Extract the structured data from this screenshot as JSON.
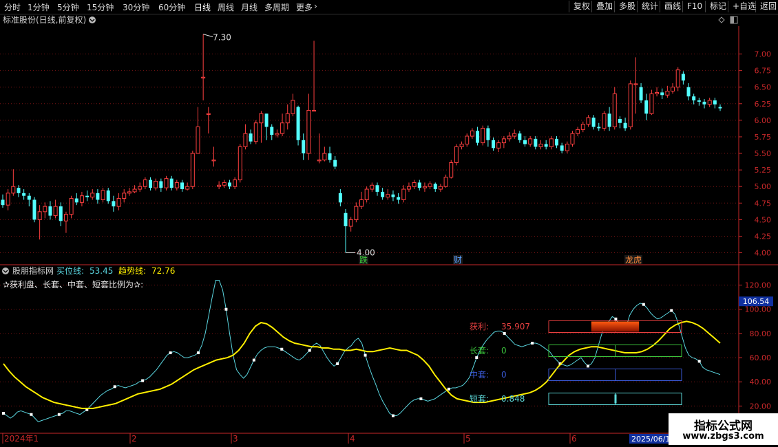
{
  "toolbar": {
    "periods": [
      "分时",
      "1分钟",
      "5分钟",
      "15分钟",
      "30分钟",
      "60分钟",
      "日线",
      "周线",
      "月线",
      "多周期",
      "更多"
    ],
    "active": "日线",
    "right": [
      "复权",
      "叠加",
      "多股",
      "统计",
      "画线",
      "F10",
      "标记",
      "+自选",
      "返回"
    ]
  },
  "main_title": "标准股份(日线,前复权)",
  "indicator": {
    "name": "股朋指标网",
    "buy_label": "买位线:",
    "buy_value": "53.45",
    "trend_label": "趋势线:",
    "trend_value": "72.76",
    "desc": "✰获利盘、长套、中套、短套比例为✰:"
  },
  "panel": {
    "rows": [
      {
        "label": "获利:",
        "value": "35.907",
        "color": "#e84040",
        "fraction": 0.35907,
        "type": "fill"
      },
      {
        "label": "长套:",
        "value": "0",
        "color": "#3cc43c",
        "fraction": 0,
        "type": "tick"
      },
      {
        "label": "中套:",
        "value": "0",
        "color": "#3a5ad8",
        "fraction": 0,
        "type": "tick"
      },
      {
        "label": "短套:",
        "value": "0.848",
        "color": "#5dd8d8",
        "fraction": 0.00848,
        "type": "tick"
      }
    ]
  },
  "current_value_tag": "106.54",
  "events": [
    {
      "text": "跌",
      "color": "#3cd03c"
    },
    {
      "text": "财",
      "color": "#5aa0ff"
    },
    {
      "text": "龙虎",
      "color": "#ff8a3a"
    }
  ],
  "time_axis": {
    "labels": [
      "2024年1",
      "2",
      "3",
      "4",
      "5",
      "6"
    ],
    "end_label": "2025/06/1"
  },
  "watermark": {
    "line1": "指标公式网",
    "line2": "www.zbgs3.com"
  },
  "chart_data": [
    {
      "type": "candlestick",
      "title": "标准股份(日线,前复权)",
      "ylim": [
        3.85,
        7.4
      ],
      "yticks": [
        4.0,
        4.25,
        4.5,
        4.75,
        5.0,
        5.25,
        5.5,
        5.75,
        6.0,
        6.25,
        6.5,
        6.75,
        7.0
      ],
      "high_label": "7.30",
      "low_label": "4.00",
      "candles": [
        [
          4.8,
          4.72,
          4.88,
          4.68
        ],
        [
          4.72,
          4.9,
          4.96,
          4.64
        ],
        [
          4.9,
          5.0,
          5.26,
          4.86
        ],
        [
          4.98,
          4.9,
          5.02,
          4.84
        ],
        [
          4.9,
          4.86,
          4.96,
          4.8
        ],
        [
          4.86,
          4.8,
          4.9,
          4.7
        ],
        [
          4.8,
          4.5,
          4.84,
          4.46
        ],
        [
          4.5,
          4.62,
          4.72,
          4.2
        ],
        [
          4.62,
          4.7,
          4.76,
          4.52
        ],
        [
          4.7,
          4.56,
          4.78,
          4.5
        ],
        [
          4.56,
          4.7,
          4.8,
          4.52
        ],
        [
          4.7,
          4.48,
          4.76,
          4.4
        ],
        [
          4.48,
          4.58,
          4.62,
          4.3
        ],
        [
          4.58,
          4.82,
          4.86,
          4.52
        ],
        [
          4.82,
          4.76,
          4.9,
          4.72
        ],
        [
          4.76,
          4.86,
          4.92,
          4.7
        ],
        [
          4.86,
          4.84,
          4.94,
          4.78
        ],
        [
          4.84,
          4.9,
          4.96,
          4.8
        ],
        [
          4.9,
          4.8,
          4.96,
          4.74
        ],
        [
          4.8,
          4.94,
          4.98,
          4.76
        ],
        [
          4.94,
          4.78,
          4.98,
          4.74
        ],
        [
          4.78,
          4.7,
          4.86,
          4.62
        ],
        [
          4.7,
          4.82,
          4.9,
          4.64
        ],
        [
          4.82,
          4.9,
          4.96,
          4.76
        ],
        [
          4.9,
          4.92,
          4.98,
          4.86
        ],
        [
          4.92,
          4.96,
          5.02,
          4.9
        ],
        [
          4.96,
          5.0,
          5.06,
          4.92
        ],
        [
          5.0,
          5.1,
          5.14,
          4.96
        ],
        [
          5.1,
          4.98,
          5.14,
          4.94
        ],
        [
          4.98,
          5.08,
          5.12,
          4.94
        ],
        [
          5.08,
          4.98,
          5.12,
          4.92
        ],
        [
          4.98,
          5.12,
          5.16,
          4.94
        ],
        [
          5.12,
          4.98,
          5.16,
          4.94
        ],
        [
          4.98,
          5.06,
          5.1,
          4.94
        ],
        [
          5.06,
          4.96,
          5.1,
          4.92
        ],
        [
          4.96,
          5.0,
          5.06,
          4.94
        ],
        [
          5.0,
          5.5,
          5.54,
          4.96
        ],
        [
          5.5,
          5.9,
          6.2,
          5.5
        ],
        [
          6.65,
          6.65,
          7.3,
          6.3
        ],
        [
          6.1,
          6.1,
          6.2,
          5.8
        ],
        [
          5.4,
          5.4,
          5.6,
          5.3
        ],
        [
          5.0,
          5.02,
          5.08,
          4.96
        ],
        [
          5.02,
          5.06,
          5.1,
          4.98
        ],
        [
          5.06,
          5.0,
          5.1,
          4.96
        ],
        [
          5.0,
          5.1,
          5.14,
          4.96
        ],
        [
          5.1,
          5.6,
          5.64,
          5.06
        ],
        [
          5.6,
          5.8,
          5.94,
          5.56
        ],
        [
          5.8,
          5.68,
          5.86,
          5.64
        ],
        [
          5.68,
          5.96,
          6.0,
          5.64
        ],
        [
          5.96,
          6.1,
          6.14,
          5.66
        ],
        [
          6.1,
          5.9,
          6.1,
          5.7
        ],
        [
          5.9,
          5.78,
          5.94,
          5.7
        ],
        [
          5.78,
          5.8,
          5.86,
          5.74
        ],
        [
          5.8,
          5.96,
          6.1,
          5.76
        ],
        [
          5.96,
          6.1,
          6.24,
          5.86
        ],
        [
          6.1,
          6.3,
          6.4,
          6.06
        ],
        [
          6.2,
          5.7,
          6.22,
          5.62
        ],
        [
          5.7,
          5.5,
          5.8,
          5.4
        ],
        [
          5.5,
          6.15,
          6.4,
          5.4
        ],
        [
          6.15,
          6.15,
          7.2,
          6.15
        ],
        [
          5.4,
          5.4,
          5.8,
          5.35
        ],
        [
          5.4,
          5.5,
          5.6,
          5.38
        ],
        [
          5.5,
          5.4,
          5.6,
          5.36
        ],
        [
          5.4,
          5.3,
          5.46,
          5.26
        ],
        [
          4.9,
          4.76,
          4.96,
          4.7
        ],
        [
          4.6,
          4.4,
          4.66,
          4.0
        ],
        [
          4.4,
          4.5,
          4.54,
          4.32
        ],
        [
          4.5,
          4.7,
          4.76,
          4.46
        ],
        [
          4.7,
          4.8,
          4.92,
          4.66
        ],
        [
          4.8,
          4.96,
          5.0,
          4.76
        ],
        [
          4.96,
          5.02,
          5.06,
          4.92
        ],
        [
          5.02,
          4.92,
          5.06,
          4.86
        ],
        [
          4.92,
          4.84,
          4.98,
          4.8
        ],
        [
          4.84,
          4.88,
          4.96,
          4.8
        ],
        [
          4.88,
          4.84,
          4.94,
          4.78
        ],
        [
          4.84,
          4.8,
          4.9,
          4.74
        ],
        [
          4.8,
          4.96,
          5.02,
          4.76
        ],
        [
          4.96,
          5.0,
          5.06,
          4.92
        ],
        [
          5.0,
          5.06,
          5.1,
          4.96
        ],
        [
          5.06,
          4.98,
          5.1,
          4.94
        ],
        [
          4.98,
          5.0,
          5.06,
          4.92
        ],
        [
          5.0,
          5.04,
          5.08,
          4.96
        ],
        [
          5.04,
          4.96,
          5.06,
          4.92
        ],
        [
          4.96,
          5.0,
          5.04,
          4.92
        ],
        [
          5.0,
          5.14,
          5.18,
          4.98
        ],
        [
          5.14,
          5.36,
          5.4,
          5.12
        ],
        [
          5.36,
          5.6,
          5.64,
          5.32
        ],
        [
          5.6,
          5.64,
          5.68,
          5.56
        ],
        [
          5.64,
          5.76,
          5.8,
          5.6
        ],
        [
          5.76,
          5.84,
          5.88,
          5.72
        ],
        [
          5.84,
          5.66,
          5.9,
          5.62
        ],
        [
          5.66,
          5.88,
          5.92,
          5.62
        ],
        [
          5.88,
          5.7,
          5.92,
          5.6
        ],
        [
          5.7,
          5.58,
          5.74,
          5.54
        ],
        [
          5.58,
          5.66,
          5.7,
          5.52
        ],
        [
          5.66,
          5.72,
          5.76,
          5.58
        ],
        [
          5.72,
          5.76,
          5.82,
          5.68
        ],
        [
          5.76,
          5.8,
          5.86,
          5.72
        ],
        [
          5.8,
          5.7,
          5.84,
          5.66
        ],
        [
          5.7,
          5.64,
          5.76,
          5.6
        ],
        [
          5.64,
          5.72,
          5.76,
          5.6
        ],
        [
          5.72,
          5.6,
          5.76,
          5.56
        ],
        [
          5.6,
          5.64,
          5.7,
          5.56
        ],
        [
          5.64,
          5.6,
          5.7,
          5.56
        ],
        [
          5.6,
          5.72,
          5.76,
          5.56
        ],
        [
          5.72,
          5.62,
          5.76,
          5.58
        ],
        [
          5.62,
          5.54,
          5.66,
          5.5
        ],
        [
          5.54,
          5.64,
          5.68,
          5.5
        ],
        [
          5.64,
          5.8,
          5.84,
          5.6
        ],
        [
          5.8,
          5.86,
          5.9,
          5.76
        ],
        [
          5.86,
          5.94,
          5.98,
          5.82
        ],
        [
          5.94,
          6.04,
          6.08,
          5.9
        ],
        [
          6.04,
          5.9,
          6.08,
          5.86
        ],
        [
          5.9,
          5.88,
          5.96,
          5.84
        ],
        [
          5.88,
          6.1,
          6.14,
          5.84
        ],
        [
          6.1,
          5.9,
          6.2,
          5.84
        ],
        [
          5.9,
          6.4,
          6.5,
          5.86
        ],
        [
          6.02,
          5.96,
          6.06,
          5.88
        ],
        [
          5.96,
          5.88,
          6.04,
          5.84
        ],
        [
          5.9,
          6.55,
          6.6,
          5.86
        ],
        [
          6.55,
          6.55,
          6.95,
          6.1
        ],
        [
          6.5,
          6.3,
          6.56,
          6.26
        ],
        [
          6.3,
          6.1,
          6.4,
          6.0
        ],
        [
          6.1,
          6.4,
          6.46,
          6.08
        ],
        [
          6.4,
          6.42,
          6.5,
          6.36
        ],
        [
          6.42,
          6.38,
          6.48,
          6.32
        ],
        [
          6.38,
          6.44,
          6.52,
          6.34
        ],
        [
          6.44,
          6.5,
          6.56,
          6.4
        ],
        [
          6.5,
          6.76,
          6.8,
          6.44
        ],
        [
          6.7,
          6.6,
          6.74,
          6.54
        ],
        [
          6.5,
          6.36,
          6.56,
          6.3
        ],
        [
          6.36,
          6.3,
          6.4,
          6.24
        ],
        [
          6.3,
          6.28,
          6.34,
          6.22
        ],
        [
          6.28,
          6.24,
          6.32,
          6.18
        ],
        [
          6.24,
          6.3,
          6.34,
          6.2
        ],
        [
          6.3,
          6.24,
          6.34,
          6.18
        ],
        [
          6.2,
          6.18,
          6.24,
          6.14
        ]
      ]
    },
    {
      "type": "line",
      "title": "股朋指标网",
      "ylim": [
        10,
        126
      ],
      "yticks": [
        20,
        40,
        60,
        80,
        100,
        120
      ],
      "series": [
        {
          "name": "买位线",
          "color": "#5ad6e0",
          "marker_every": 8,
          "values": [
            14,
            12,
            10,
            12,
            15,
            16,
            15,
            14,
            13,
            10,
            7,
            8,
            9,
            10,
            11,
            12,
            13,
            14,
            16,
            16,
            15,
            14,
            13,
            15,
            17,
            20,
            23,
            26,
            29,
            31,
            33,
            34,
            36,
            37,
            36,
            35,
            36,
            37,
            38,
            40,
            41,
            42,
            44,
            47,
            50,
            54,
            58,
            62,
            64,
            65,
            64,
            62,
            60,
            60,
            61,
            62,
            64,
            70,
            80,
            95,
            110,
            124,
            124,
            116,
            100,
            80,
            62,
            50,
            46,
            43,
            46,
            52,
            58,
            63,
            66,
            68,
            69,
            69,
            69,
            68,
            67,
            65,
            63,
            61,
            59,
            58,
            60,
            63,
            66,
            70,
            72,
            70,
            65,
            60,
            56,
            53,
            55,
            60,
            65,
            68,
            70,
            74,
            76,
            72,
            62,
            53,
            45,
            38,
            30,
            24,
            19,
            14,
            12,
            12,
            14,
            17,
            20,
            23,
            25,
            26,
            26,
            25,
            24,
            25,
            26,
            28,
            30,
            32,
            34,
            35,
            35,
            36,
            37,
            40,
            44,
            52,
            60,
            66,
            71,
            75,
            78,
            81,
            82,
            82,
            80,
            77,
            74,
            71,
            70,
            69,
            70,
            71,
            72,
            72,
            71,
            69,
            67,
            65,
            61,
            58,
            55,
            54,
            53,
            54,
            56,
            58,
            60,
            56,
            53,
            55,
            60,
            70,
            80,
            86,
            90,
            94,
            92,
            88,
            84,
            86,
            95,
            100,
            103,
            105,
            104,
            101,
            97,
            94,
            92,
            93,
            95,
            97,
            99,
            96,
            88,
            78,
            68,
            62,
            60,
            59,
            57,
            52,
            50,
            49,
            48,
            47,
            46
          ]
        },
        {
          "name": "趋势线",
          "color": "#ffef00",
          "marker_every": 0,
          "values": [
            55,
            49,
            44,
            40,
            36,
            33,
            30,
            27,
            25,
            23,
            22,
            21,
            20,
            19,
            18,
            18,
            18,
            19,
            20,
            21,
            22,
            24,
            26,
            28,
            30,
            31,
            32,
            33,
            34,
            36,
            38,
            41,
            44,
            47,
            50,
            52,
            54,
            56,
            58,
            59,
            60,
            62,
            66,
            72,
            80,
            86,
            89,
            88,
            85,
            81,
            77,
            74,
            72,
            71,
            70,
            69,
            69,
            68,
            68,
            67,
            67,
            66,
            66,
            67,
            66,
            65,
            65,
            66,
            67,
            68,
            67,
            66,
            66,
            64,
            62,
            58,
            53,
            46,
            40,
            34,
            29,
            26,
            25,
            24,
            23,
            23,
            23,
            24,
            25,
            26,
            27,
            28,
            29,
            30,
            31,
            33,
            36,
            40,
            46,
            52,
            57,
            62,
            65,
            67,
            68,
            69,
            69,
            68,
            67,
            66,
            65,
            64,
            64,
            64,
            65,
            67,
            70,
            74,
            79,
            84,
            87,
            89,
            90,
            89,
            87,
            84,
            80,
            76,
            72
          ]
        }
      ]
    }
  ]
}
